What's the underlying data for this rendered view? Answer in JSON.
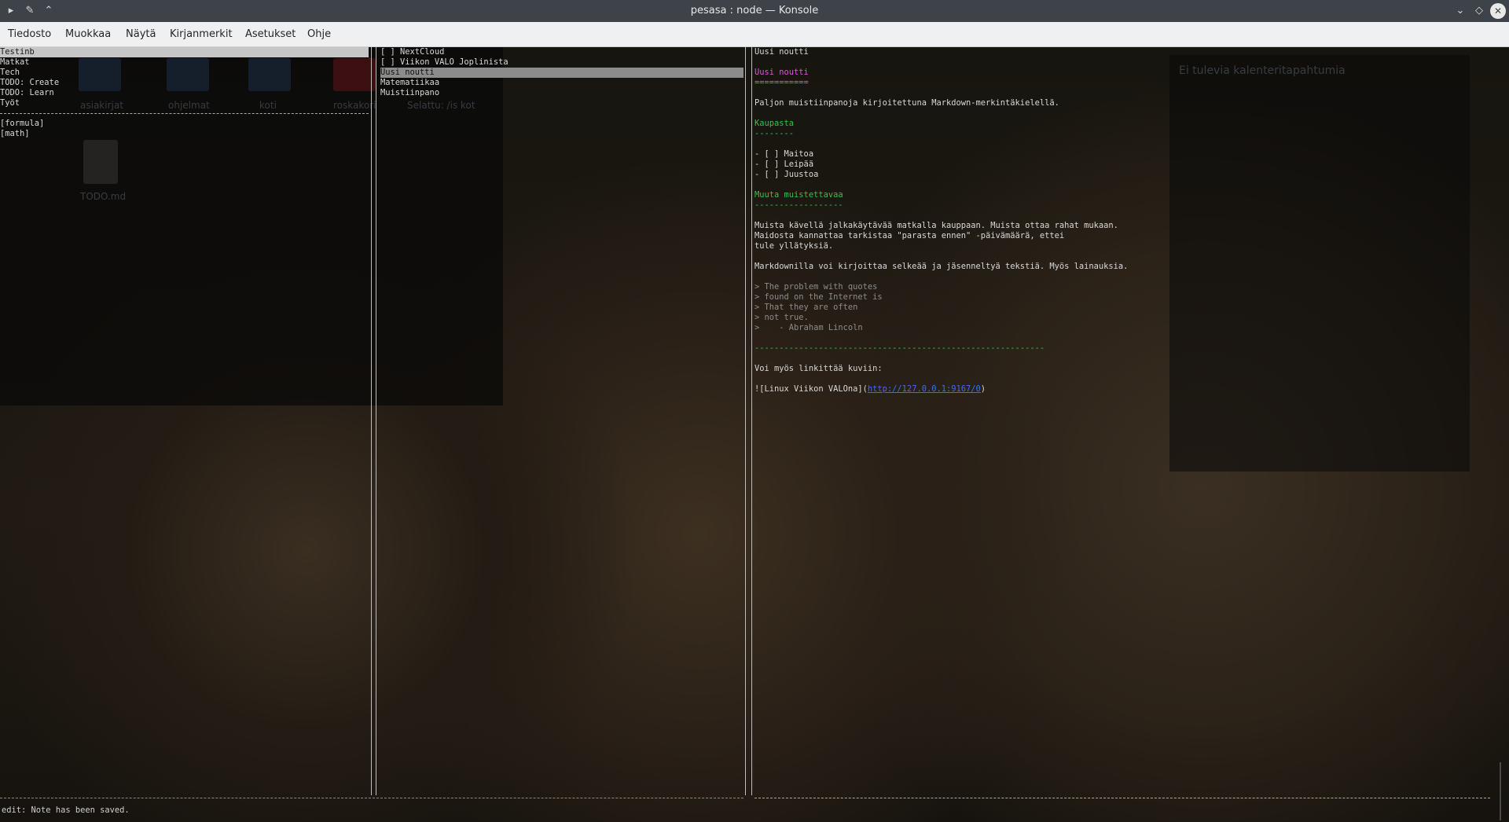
{
  "window": {
    "title": "pesasa : node — Konsole"
  },
  "menubar": {
    "items": [
      "Tiedosto",
      "Muokkaa",
      "Näytä",
      "Kirjanmerkit",
      "Asetukset",
      "Ohje"
    ]
  },
  "notebooks": {
    "items": [
      "Testinb",
      "Matkat",
      "Tech",
      "TODO: Create",
      "TODO: Learn",
      "Työt"
    ],
    "selected": "Testinb",
    "tags": [
      "[formula]",
      "[math]"
    ]
  },
  "notes": {
    "items": [
      "[ ] NextCloud",
      "[ ] Viikon VALO Joplinista",
      "Uusi noutti",
      "Matematiikaa",
      "Muistiinpano"
    ],
    "selected": "Uusi noutti"
  },
  "editor": {
    "title": "Uusi noutti",
    "heading": "Uusi noutti",
    "heading_underline": "===========",
    "intro": "Paljon muistiinpanoja kirjoitettuna Markdown-merkintäkielellä.",
    "shop_heading": "Kaupasta",
    "shop_underline": "--------",
    "shop_items": [
      "- [ ] Maitoa",
      "- [ ] Leipää",
      "- [ ] Juustoa"
    ],
    "other_heading": "Muuta muistettavaa",
    "other_underline": "------------------",
    "para1": [
      "Muista kävellä jalkakäytävää matkalla kauppaan. Muista ottaa rahat mukaan.",
      "Maidosta kannattaa tarkistaa \"parasta ennen\" -päivämäärä, ettei",
      "tule yllätyksiä."
    ],
    "para2": "Markdownilla voi kirjoittaa selkeää ja jäsenneltyä tekstiä. Myös lainauksia.",
    "quote": [
      "> The problem with quotes",
      "> found on the Internet is",
      "> That they are often",
      "> not true.",
      ">    - Abraham Lincoln"
    ],
    "rule": "-----------------------------------------------------------",
    "links_line": "Voi myös linkittää kuviin:",
    "image_prefix": "![Linux Viikon VALOna](",
    "image_url": "http://127.0.0.1:9167/0",
    "image_suffix": ")"
  },
  "status": {
    "text": "edit: Note has been saved."
  },
  "background_ghost": {
    "icons": [
      "asiakirjat",
      "ohjelmat",
      "koti",
      "roskakori"
    ],
    "file": "TODO.md",
    "panel_title": "Ei tulevia kalenteritapahtumia",
    "path": "Selattu: /is kot"
  },
  "colors": {
    "heading": "#d85ad8",
    "subheading": "#35c24a",
    "link": "#3b6ff0",
    "quote": "#8c8c8c"
  }
}
